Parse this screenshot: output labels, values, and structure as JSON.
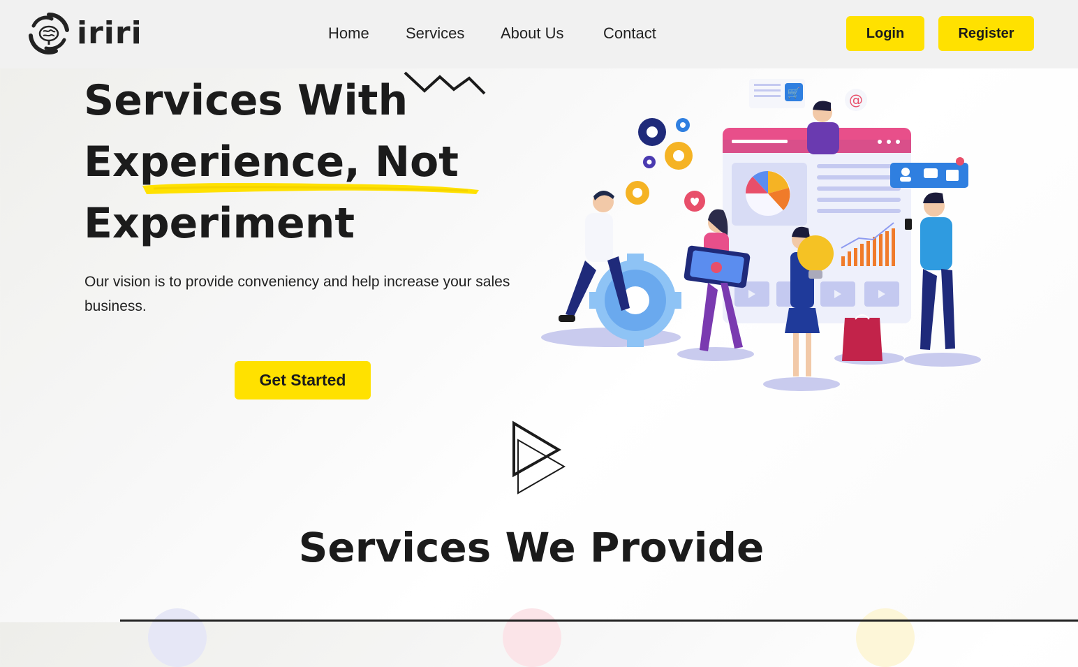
{
  "brand": {
    "name": "iriri"
  },
  "nav": {
    "items": [
      {
        "label": "Home"
      },
      {
        "label": "Services"
      },
      {
        "label": "About Us"
      },
      {
        "label": "Contact"
      }
    ]
  },
  "auth": {
    "login_label": "Login",
    "register_label": "Register"
  },
  "hero": {
    "title_line1": "Services With",
    "title_line2": "Experience, Not",
    "title_line3": "Experiment",
    "description": "Our vision is to provide conveniency and help increase your sales business.",
    "cta_label": "Get Started"
  },
  "services": {
    "title": "Services We Provide"
  },
  "colors": {
    "accent": "#ffe100",
    "text": "#1b1b1b",
    "header_bg": "#f1f1f1"
  }
}
